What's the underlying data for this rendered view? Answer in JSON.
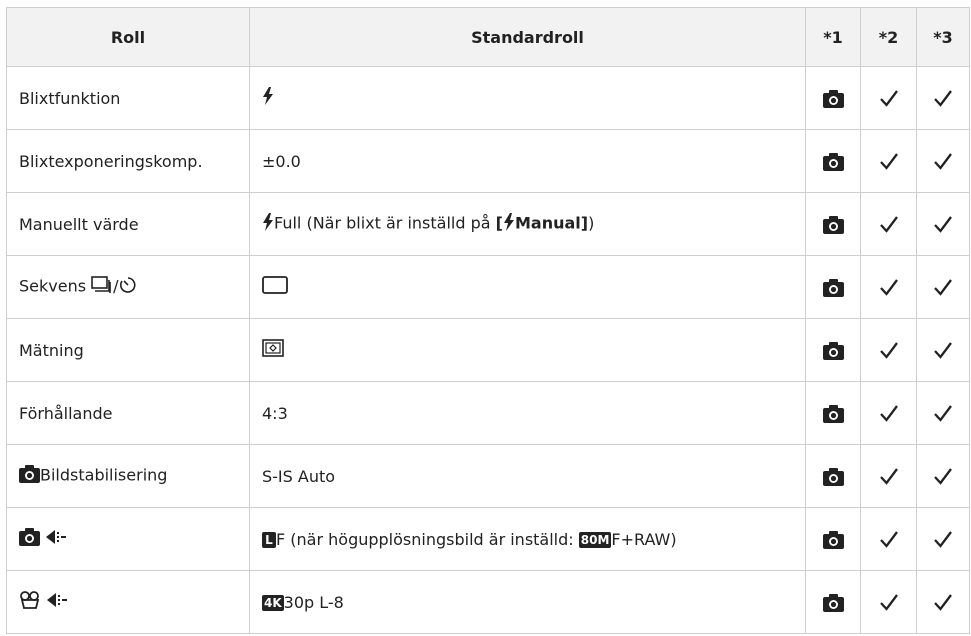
{
  "header": {
    "col1": "Roll",
    "col2": "Standardroll",
    "col3": "*1",
    "col4": "*2",
    "col5": "*3"
  },
  "rows": [
    {
      "name": "Blixtfunktion",
      "value": ""
    },
    {
      "name": "Blixtexponeringskomp.",
      "value": "±0.0"
    },
    {
      "name": "Manuellt värde",
      "value_pre": "Full (När blixt är inställd på ",
      "value_bold": "[",
      "value_bold2": "Manual]",
      "value_post": ")"
    },
    {
      "name": "Sekvens ",
      "name_sep": "/",
      "value": ""
    },
    {
      "name": "Mätning",
      "value": ""
    },
    {
      "name": "Förhållande",
      "value": "4:3"
    },
    {
      "name": "Bildstabilisering",
      "value": "S-IS Auto"
    },
    {
      "name": "",
      "value_badge": "L",
      "value": "F (när högupplösningsbild är inställd: ",
      "value_badge2": "80M",
      "value_post": "F+RAW)"
    },
    {
      "name": "",
      "value_badge": "4K",
      "value": "30p L-8"
    }
  ],
  "icons": {
    "row_col1": "camera-icon",
    "row_col2": "checkmark-icon",
    "row_col3": "checkmark-icon"
  }
}
